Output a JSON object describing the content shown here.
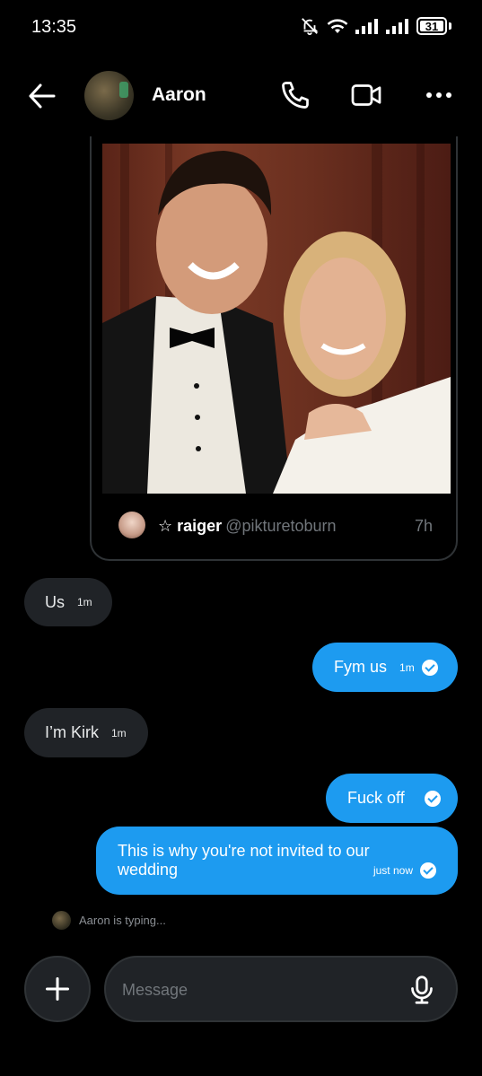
{
  "status_bar": {
    "time": "13:35",
    "battery": "31"
  },
  "header": {
    "contact_name": "Aaron"
  },
  "tweet_card": {
    "author_star": "☆",
    "author_name": "raiger",
    "author_handle": "@pikturetoburn",
    "time": "7h"
  },
  "messages": [
    {
      "direction": "in",
      "text": "Us",
      "time": "1m"
    },
    {
      "direction": "out",
      "text": "Fym us",
      "time": "1m"
    },
    {
      "direction": "in",
      "text": "I’m Kirk",
      "time": "1m"
    },
    {
      "direction": "out",
      "text": "Fuck off",
      "time": ""
    },
    {
      "direction": "out",
      "text": "This is why you're not invited to our wedding",
      "time": "just now"
    }
  ],
  "typing_indicator": "Aaron is typing...",
  "composer": {
    "placeholder": "Message"
  },
  "colors": {
    "accent": "#1d9bf0",
    "incoming_bubble": "#202327",
    "background": "#000000"
  }
}
